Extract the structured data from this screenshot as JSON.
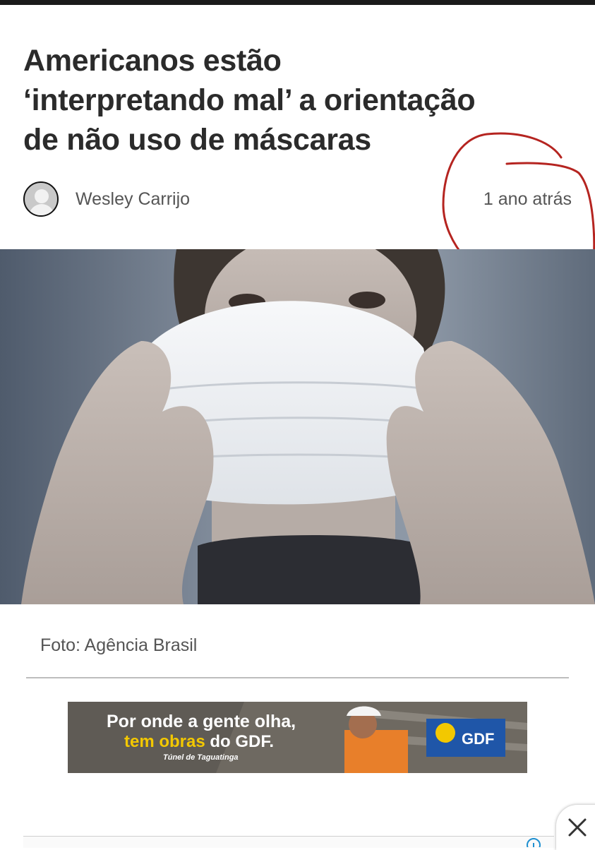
{
  "article": {
    "headline_lines": [
      "Americanos estão",
      "‘interpretando mal’ a orientação",
      "de não uso de máscaras"
    ],
    "author": "Wesley Carrijo",
    "time_ago": "1 ano atrás",
    "photo_caption": "Foto: Agência Brasil",
    "photo_alt": "Pessoa segurando máscara descartável branca"
  },
  "ad": {
    "line1": "Por onde a gente olha,",
    "line2_highlight": "tem obras",
    "line2_rest": " do GDF.",
    "subtitle": "Túnel de Taguatinga",
    "brand": "GDF"
  },
  "colors": {
    "annotation_red": "#b52420",
    "ad_yellow": "#f3c800",
    "gdf_blue": "#1f56a8"
  },
  "icons": {
    "close": "close-icon",
    "info": "info-icon",
    "avatar": "user-avatar-icon"
  }
}
